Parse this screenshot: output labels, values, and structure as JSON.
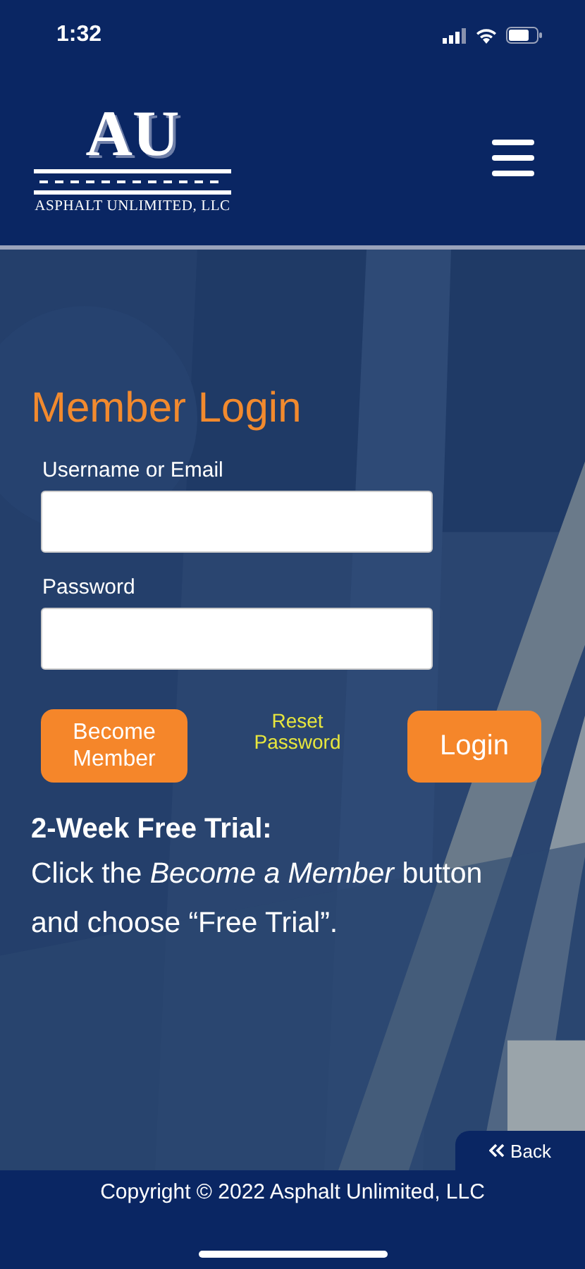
{
  "status_bar": {
    "time": "1:32"
  },
  "header": {
    "logo": {
      "letters": "AU",
      "name": "ASPHALT UNLIMITED, LLC"
    }
  },
  "login": {
    "title": "Member Login",
    "fields": [
      {
        "label": "Username or Email"
      },
      {
        "label": "Password"
      }
    ],
    "become_button": "Become Member",
    "reset_link": "Reset Password",
    "login_button": "Login"
  },
  "trial": {
    "heading": "2-Week Free Trial:",
    "text": "Click the *Become a Member* button and choose “Free Trial”."
  },
  "back_button": "Back",
  "footer": {
    "copyright": "Copyright © 2022 Asphalt Unlimited, LLC"
  }
}
